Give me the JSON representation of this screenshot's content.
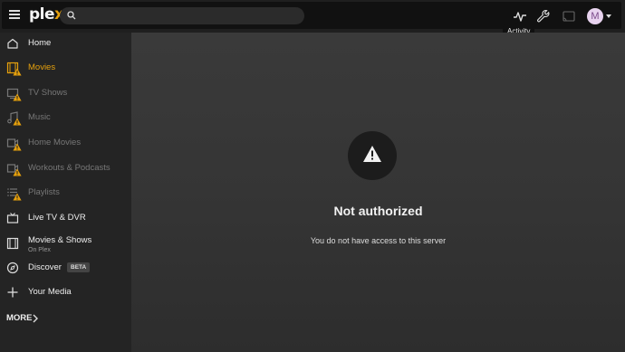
{
  "app": {
    "logo_main": "ple",
    "logo_accent": "x"
  },
  "search": {
    "placeholder": "",
    "value": ""
  },
  "toolbar": {
    "activity_icon": "activity-icon",
    "settings_icon": "wrench-icon",
    "cast_icon": "cast-icon",
    "user_initial": "M",
    "tooltip": "Activity"
  },
  "sidebar": {
    "items": [
      {
        "label": "Home",
        "icon": "home-icon",
        "state": "normal",
        "warning": false
      },
      {
        "label": "Movies",
        "icon": "film-icon",
        "state": "active",
        "warning": true
      },
      {
        "label": "TV Shows",
        "icon": "tv-icon",
        "state": "dim",
        "warning": true
      },
      {
        "label": "Music",
        "icon": "music-icon",
        "state": "dim",
        "warning": true
      },
      {
        "label": "Home Movies",
        "icon": "video-icon",
        "state": "dim",
        "warning": true
      },
      {
        "label": "Workouts & Podcasts",
        "icon": "video-icon",
        "state": "dim",
        "warning": true
      },
      {
        "label": "Playlists",
        "icon": "playlist-icon",
        "state": "dim",
        "warning": true
      },
      {
        "label": "Live TV & DVR",
        "icon": "live-tv-icon",
        "state": "normal",
        "warning": false
      },
      {
        "label": "Movies & Shows",
        "sub": "On Plex",
        "icon": "film-icon",
        "state": "normal",
        "warning": false
      },
      {
        "label": "Discover",
        "badge": "BETA",
        "icon": "compass-icon",
        "state": "normal",
        "warning": false
      },
      {
        "label": "Your Media",
        "icon": "plus-icon",
        "state": "normal",
        "warning": false
      }
    ],
    "more_label": "MORE"
  },
  "main": {
    "error_title": "Not authorized",
    "error_message": "You do not have access to this server"
  },
  "colors": {
    "accent": "#e5a00d",
    "background": "#1f1f1f",
    "sidebar": "#242424",
    "main": "#353535"
  }
}
